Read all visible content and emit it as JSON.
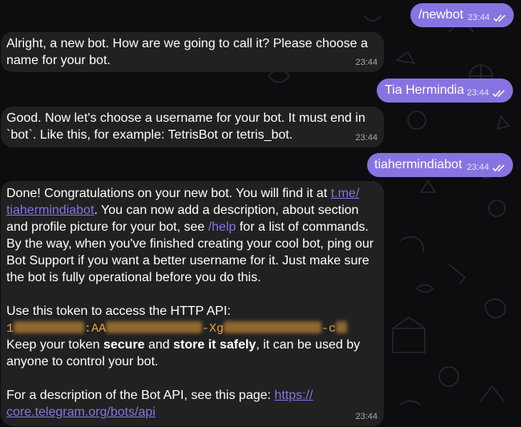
{
  "messages": [
    {
      "from": "me",
      "text": "/newbot",
      "time": "23:44"
    },
    {
      "from": "bot",
      "line1": "Alright, a new bot. How are we going to call it? Please choose a",
      "line2": "name for your bot.",
      "time": "23:44"
    },
    {
      "from": "me",
      "text": "Tia Hermindia",
      "time": "23:44"
    },
    {
      "from": "bot",
      "line1": "Good. Now let's choose a username for your bot. It must end in",
      "line2": "`bot`. Like this, for example: TetrisBot or tetris_bot.",
      "time": "23:44"
    },
    {
      "from": "me",
      "text": "tiahermindiabot",
      "time": "23:44"
    },
    {
      "from": "bot",
      "time": "23:44",
      "p1_a": "Done! Congratulations on your new bot. You will find it at ",
      "link1_a": "t.me/",
      "link1_b": "tiahermindiabot",
      "p1_b": ". You can now add a description, about section",
      "p1_c": "and profile picture for your bot, see ",
      "cmd": "/help",
      "p1_d": " for a list of commands.",
      "p1_e": "By the way, when you've finished creating your cool bot, ping our",
      "p1_f": "Bot Support if you want a better username for it. Just make sure",
      "p1_g": "the bot is fully operational before you do this.",
      "p2": "Use this token to access the HTTP API:",
      "token_1": "1",
      "token_2": ":AA",
      "token_3": "-Xg",
      "token_4": "-c",
      "p3_a": "Keep your token ",
      "p3_b1": "secure",
      "p3_c": " and ",
      "p3_b2": "store it safely",
      "p3_d": ", it can be used by",
      "p3_e": "anyone to control your bot.",
      "p4_a": "For a description of the Bot API, see this page: ",
      "link2_a": "https://",
      "link2_b": "core.telegram.org/bots/api"
    }
  ],
  "colors": {
    "outgoing": "#8774e1",
    "incoming": "#212121",
    "background": "#0d0d10",
    "link": "#8774e1",
    "token": "#e8a23d"
  }
}
